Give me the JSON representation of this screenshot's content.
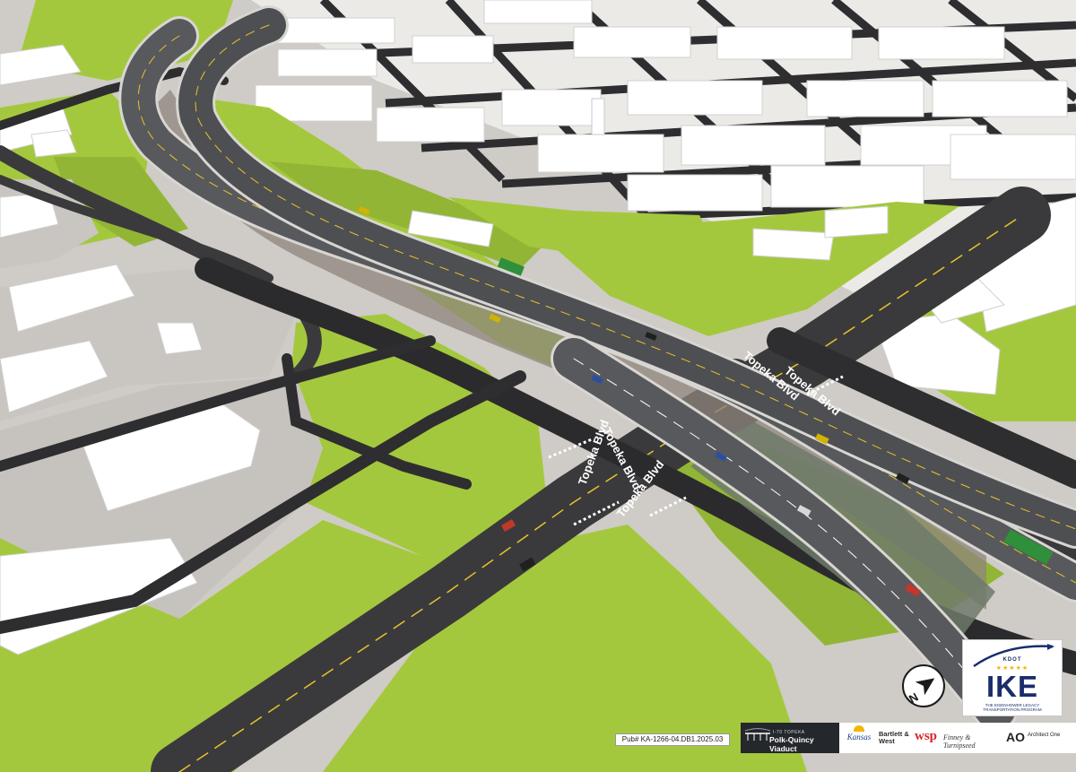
{
  "image": {
    "kind": "3D aerial rendering of a highway viaduct and street grid",
    "colors": {
      "lawn": "#a4c83d",
      "lawn_dark": "#93b535",
      "ground": "#cfcbc6",
      "lot": "#c9c5c0",
      "asphalt": "#3a3a3c",
      "asphalt_dark": "#2b2b2d",
      "viaduct_deck": "#58595c",
      "viaduct_edge": "#d8d6d2",
      "underside": "#8f857c",
      "lane_yellow": "#e8c32a",
      "building": "#ffffff",
      "building_shade": "#dcdcdc",
      "brand_navy": "#1a2d6b",
      "brand_gold": "#f2b705"
    }
  },
  "street_labels": [
    {
      "text": "Topeka Blvd"
    },
    {
      "text": "Topeka Blvd"
    },
    {
      "text": "Topeka Blvd"
    },
    {
      "text": "Topeka Blvd"
    }
  ],
  "compass": {
    "letter": "N",
    "icon": "north-arrow-icon"
  },
  "ike_logo": {
    "agency": "KDOT",
    "stars": "★★★★★",
    "word": "IKE",
    "tagline": "The Eisenhower Legacy Transportation Program"
  },
  "pub_number": "Pub# KA-1266-04.DB1.2025.03",
  "project_banner": {
    "subtitle": "I-70 TOPEKA",
    "name": "Polk-Quincy Viaduct"
  },
  "partners": [
    {
      "name": "Kansas"
    },
    {
      "name": "Bartlett & West"
    },
    {
      "name": "wsp"
    },
    {
      "name": "Finney & Turnipseed"
    },
    {
      "name": "AO",
      "sub": "Architect One"
    }
  ]
}
